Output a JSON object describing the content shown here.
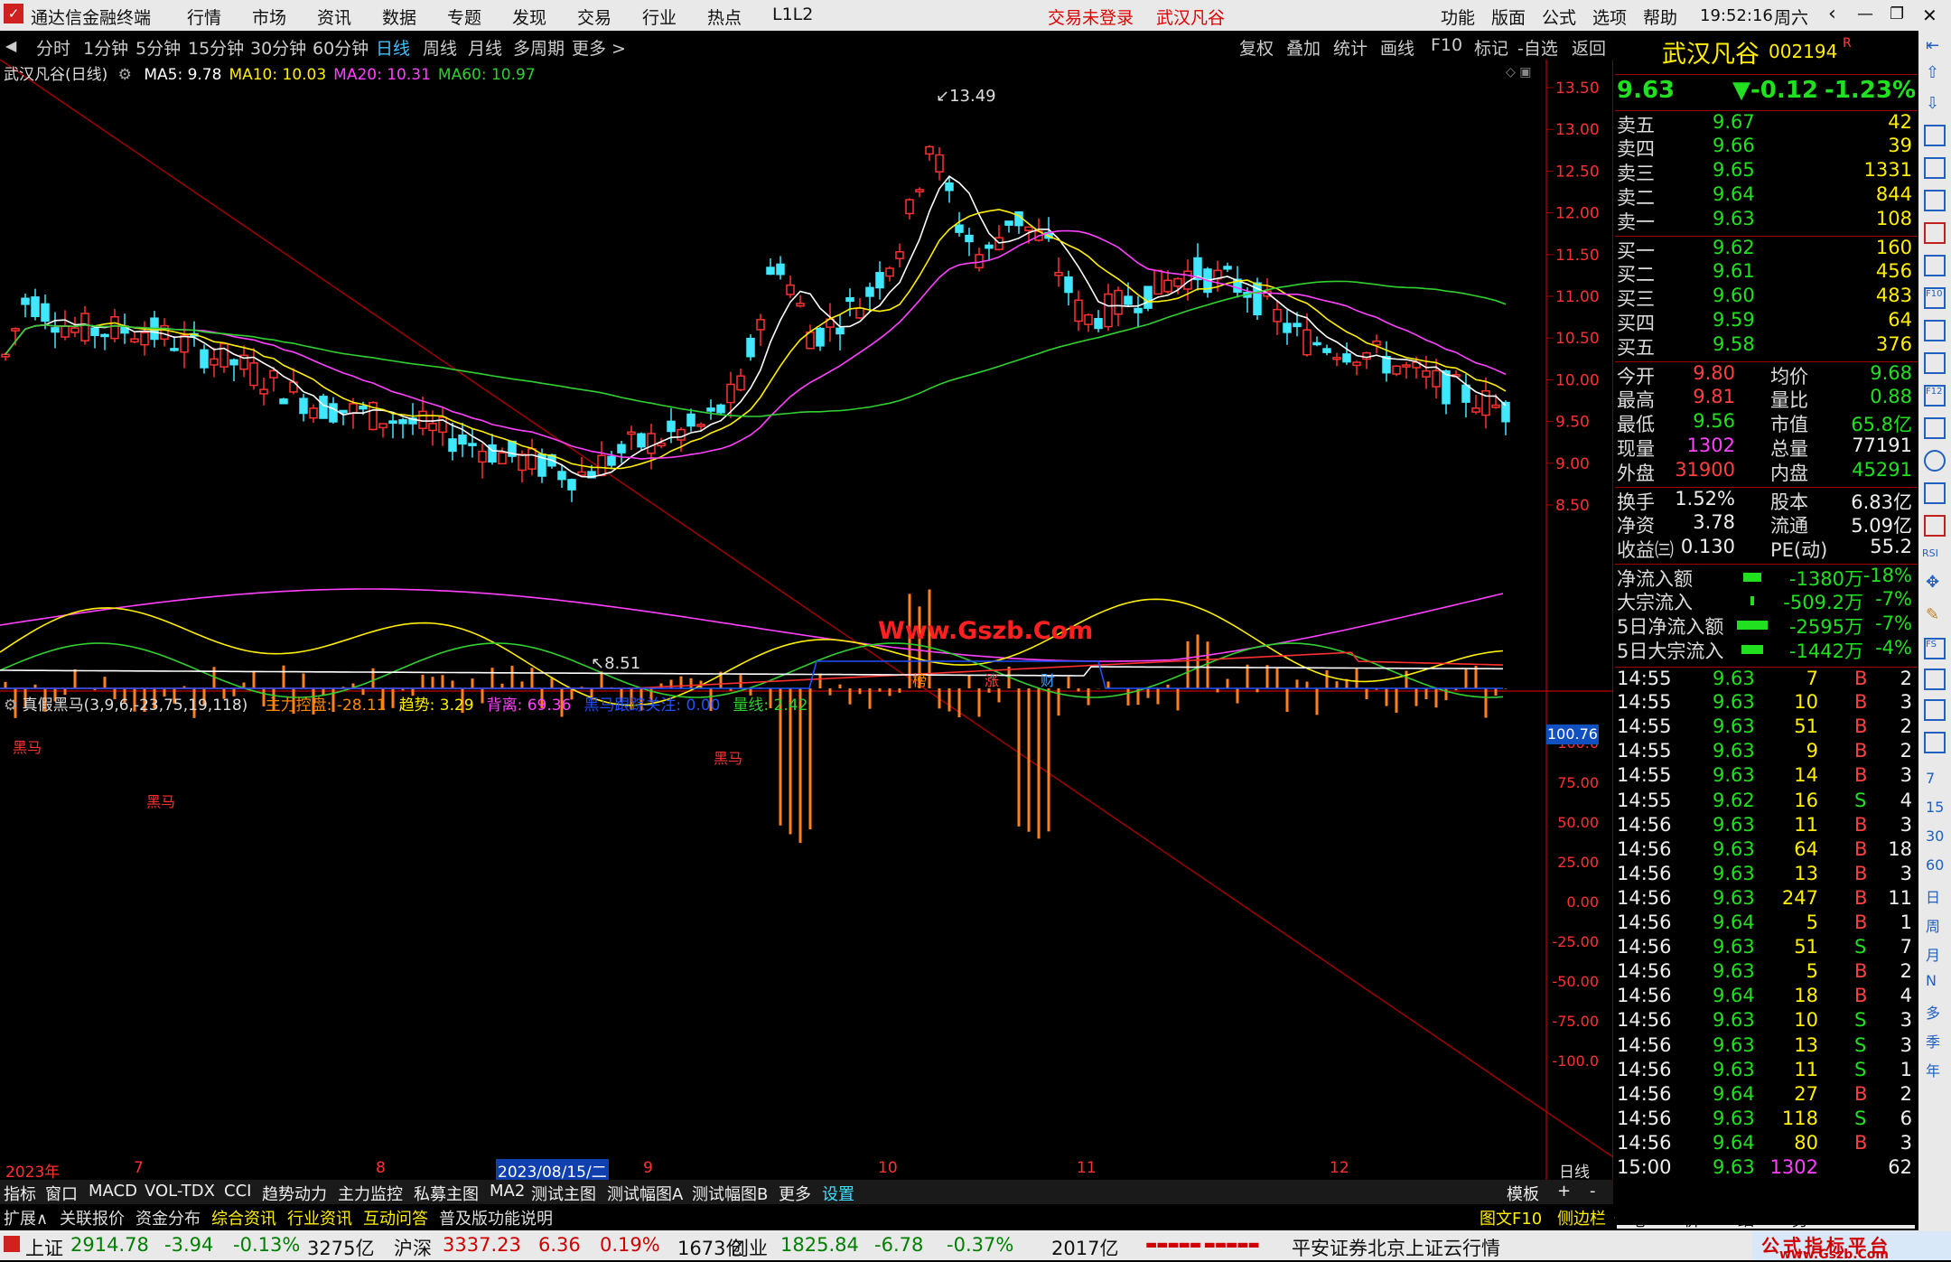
{
  "app": {
    "title": "通达信金融终端",
    "menus": [
      "行情",
      "市场",
      "资讯",
      "数据",
      "专题",
      "发现",
      "交易",
      "行业",
      "热点",
      "L1L2"
    ],
    "login_status": "交易未登录",
    "stock_title": "武汉凡谷",
    "right_menus": [
      "功能",
      "版面",
      "公式",
      "选项",
      "帮助"
    ],
    "time": "19:52:16",
    "weekday": "周六"
  },
  "periods": [
    "分时",
    "1分钟",
    "5分钟",
    "15分钟",
    "30分钟",
    "60分钟",
    "日线",
    "周线",
    "月线",
    "多周期",
    "更多 >"
  ],
  "tools": [
    "复权",
    "叠加",
    "统计",
    "画线",
    "F10",
    "标记",
    "-自选",
    "返回"
  ],
  "chart": {
    "caption": "武汉凡谷(日线)",
    "ma": [
      {
        "name": "MA5: 9.78",
        "color": "#ffffff"
      },
      {
        "name": "MA10: 10.03",
        "color": "#ffee00"
      },
      {
        "name": "MA20: 10.31",
        "color": "#ff40ff"
      },
      {
        "name": "MA60: 10.97",
        "color": "#30d030"
      }
    ],
    "high_label": "13.49",
    "low_label": "8.51",
    "watermark": "Www.Gszb.Com",
    "events": [
      "榜",
      "涨",
      "财"
    ],
    "yticks": [
      "13.50",
      "13.00",
      "12.50",
      "12.00",
      "11.50",
      "11.00",
      "10.50",
      "10.00",
      "9.50",
      "9.00",
      "8.50"
    ]
  },
  "indicator": {
    "caption": "真假黑马(3,9,6,-23,75,19,118)",
    "items": [
      {
        "t": "主力控盘: -28.11",
        "c": "#ff8800"
      },
      {
        "t": "趋势: 3.29",
        "c": "#ffee00"
      },
      {
        "t": "背离: 69.36",
        "c": "#ff40ff"
      },
      {
        "t": "黑马跟踪关注: 0.00",
        "c": "#2050ff"
      },
      {
        "t": "量线: 2.42",
        "c": "#30d030"
      }
    ],
    "current": "100.76",
    "marks": [
      "黑马",
      "黑马",
      "黑马"
    ],
    "yticks": [
      "100.0",
      "75.00",
      "50.00",
      "25.00",
      "0.00",
      "-25.00",
      "-50.00",
      "-75.00",
      "-100.0"
    ]
  },
  "xaxis": {
    "labels": [
      "2023年",
      "7",
      "8",
      "2023/08/15/二",
      "9",
      "10",
      "11",
      "12"
    ],
    "right": "日线"
  },
  "bottom_tabs": [
    "指标",
    "窗口",
    "MACD",
    "VOL-TDX",
    "CCI",
    "趋势动力",
    "主力监控",
    "私募主图",
    "MA2",
    "测试主图",
    "测试幅图A",
    "测试幅图B",
    "更多",
    "设置"
  ],
  "bottom_right": [
    "模板",
    "+",
    "-"
  ],
  "tabs2": [
    "扩展∧",
    "关联报价",
    "资金分布",
    "综合资讯",
    "行业资讯",
    "互动问答",
    "普及版功能说明"
  ],
  "tabs2_right": [
    "图文F10",
    "侧边栏《",
    "笔",
    "价",
    "细",
    "势"
  ],
  "quote": {
    "name": "武汉凡谷",
    "code": "002194",
    "flag": "R",
    "price": "9.63",
    "change": "▼-0.12",
    "pct": "-1.23%",
    "sells": [
      [
        "卖五",
        "9.67",
        "42"
      ],
      [
        "卖四",
        "9.66",
        "39"
      ],
      [
        "卖三",
        "9.65",
        "1331"
      ],
      [
        "卖二",
        "9.64",
        "844"
      ],
      [
        "卖一",
        "9.63",
        "108"
      ]
    ],
    "buys": [
      [
        "买一",
        "9.62",
        "160"
      ],
      [
        "买二",
        "9.61",
        "456"
      ],
      [
        "买三",
        "9.60",
        "483"
      ],
      [
        "买四",
        "9.59",
        "64"
      ],
      [
        "买五",
        "9.58",
        "376"
      ]
    ],
    "stats": [
      [
        "今开",
        "9.80",
        "均价",
        "9.68"
      ],
      [
        "最高",
        "9.81",
        "量比",
        "0.88"
      ],
      [
        "最低",
        "9.56",
        "市值",
        "65.8亿"
      ],
      [
        "现量",
        "1302",
        "总量",
        "77191"
      ],
      [
        "外盘",
        "31900",
        "内盘",
        "45291"
      ]
    ],
    "stats2": [
      [
        "换手",
        "1.52%",
        "股本",
        "6.83亿"
      ],
      [
        "净资",
        "3.78",
        "流通",
        "5.09亿"
      ],
      [
        "收益㈢",
        "0.130",
        "PE(动)",
        "55.2"
      ]
    ],
    "flows": [
      [
        "净流入额",
        "-1380万",
        "-18%"
      ],
      [
        "大宗流入",
        "-509.2万",
        "-7%"
      ],
      [
        "5日净流入额",
        "-2595万",
        "-7%"
      ],
      [
        "5日大宗流入",
        "-1442万",
        "-4%"
      ]
    ],
    "ticks": [
      [
        "14:55",
        "9.63",
        "7",
        "B",
        "2"
      ],
      [
        "14:55",
        "9.63",
        "10",
        "B",
        "3"
      ],
      [
        "14:55",
        "9.63",
        "51",
        "B",
        "2"
      ],
      [
        "14:55",
        "9.63",
        "9",
        "B",
        "2"
      ],
      [
        "14:55",
        "9.63",
        "14",
        "B",
        "3"
      ],
      [
        "14:55",
        "9.62",
        "16",
        "S",
        "4"
      ],
      [
        "14:56",
        "9.63",
        "11",
        "B",
        "3"
      ],
      [
        "14:56",
        "9.63",
        "64",
        "B",
        "18"
      ],
      [
        "14:56",
        "9.63",
        "13",
        "B",
        "3"
      ],
      [
        "14:56",
        "9.63",
        "247",
        "B",
        "11"
      ],
      [
        "14:56",
        "9.64",
        "5",
        "B",
        "1"
      ],
      [
        "14:56",
        "9.63",
        "51",
        "S",
        "7"
      ],
      [
        "14:56",
        "9.63",
        "5",
        "B",
        "2"
      ],
      [
        "14:56",
        "9.64",
        "18",
        "B",
        "4"
      ],
      [
        "14:56",
        "9.63",
        "10",
        "S",
        "3"
      ],
      [
        "14:56",
        "9.63",
        "13",
        "S",
        "3"
      ],
      [
        "14:56",
        "9.63",
        "11",
        "S",
        "1"
      ],
      [
        "14:56",
        "9.64",
        "27",
        "B",
        "2"
      ],
      [
        "14:56",
        "9.63",
        "118",
        "S",
        "6"
      ],
      [
        "14:56",
        "9.64",
        "80",
        "B",
        "3"
      ],
      [
        "15:00",
        "9.63",
        "1302",
        "",
        "62"
      ]
    ]
  },
  "status": {
    "items": [
      {
        "t": "上证",
        "c": "#111"
      },
      {
        "t": "2914.78",
        "c": "#008000"
      },
      {
        "t": "-3.94",
        "c": "#008000"
      },
      {
        "t": "-0.13%",
        "c": "#008000"
      },
      {
        "t": "3275亿",
        "c": "#111"
      },
      {
        "t": "沪深",
        "c": "#111"
      },
      {
        "t": "3337.23",
        "c": "#d00000"
      },
      {
        "t": "6.36",
        "c": "#d00000"
      },
      {
        "t": "0.19%",
        "c": "#d00000"
      },
      {
        "t": "1673亿",
        "c": "#111"
      },
      {
        "t": "创业",
        "c": "#111"
      },
      {
        "t": "1825.84",
        "c": "#008000"
      },
      {
        "t": "-6.78",
        "c": "#008000"
      },
      {
        "t": "-0.37%",
        "c": "#008000"
      },
      {
        "t": "2017亿",
        "c": "#111"
      }
    ],
    "broker": "平安证券北京上证云行情",
    "logo": "公式指标平台",
    "logo_url": "www.Gszb.Com"
  },
  "side_icons": [
    "7",
    "15",
    "30",
    "60",
    "日",
    "周",
    "月",
    "N",
    "多",
    "季",
    "年"
  ]
}
